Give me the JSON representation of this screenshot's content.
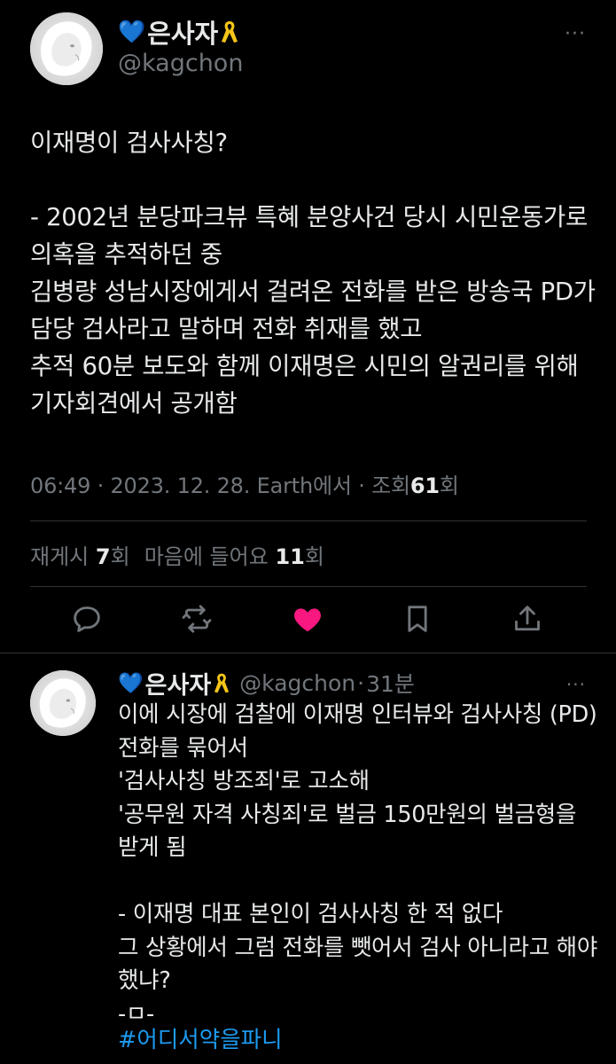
{
  "main_tweet": {
    "display_name": "은사자",
    "name_emoji_before": "💙",
    "handle": "@kagchon",
    "more_glyph": "···",
    "text": "이재명이 검사사칭?\n\n- 2002년 분당파크뷰 특혜 분양사건 당시 시민운동가로 의혹을 추적하던 중\n김병량 성남시장에게서 걸려온 전화를 받은 방송국 PD가 담당 검사라고 말하며 전화 취재를 했고\n추적 60분 보도와 함께 이재명은 시민의 알권리를 위해 기자회견에서 공개함",
    "time": "06:49",
    "date": "2023. 12. 28.",
    "source": "Earth에서",
    "views_label": "조회",
    "views_count": "61",
    "views_unit": "회",
    "sep": "·",
    "reposts_label": "재게시",
    "reposts_count": "7",
    "reposts_unit": "회",
    "likes_label": "마음에 들어요",
    "likes_count": "11",
    "likes_unit": "회"
  },
  "actions": [
    "reply-icon",
    "repost-icon",
    "like-icon",
    "bookmark-icon",
    "share-icon"
  ],
  "colors": {
    "background": "#000000",
    "text": "#e7e9ea",
    "secondary": "#71767b",
    "divider": "#2f3336",
    "like": "#f91880",
    "link": "#1d9bf0"
  },
  "reply_tweet": {
    "display_name": "은사자",
    "name_emoji_before": "💙",
    "handle": "@kagchon",
    "dot": "·",
    "time": "31분",
    "more_glyph": "···",
    "text": "이에 시장에 검찰에 이재명 인터뷰와 검사사칭 (PD) 전화를 묶어서\n'검사사칭 방조죄'로 고소해\n'공무원 자격 사칭죄'로 벌금 150만원의 벌금형을 받게 됨\n\n- 이재명 대표 본인이 검사사칭 한 적 없다\n그 상황에서 그럼 전화를 뺏어서 검사 아니라고 해야 했냐?\n-ㅁ-",
    "hashtag": "#어디서약을파니"
  }
}
